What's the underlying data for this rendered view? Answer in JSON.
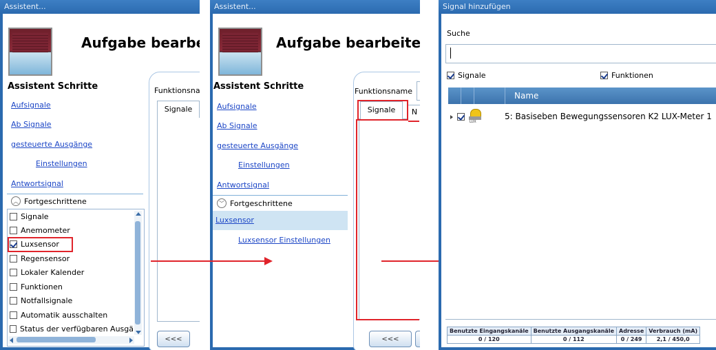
{
  "panel1": {
    "title": "Assistent...",
    "task_title": "Aufgabe bearbe",
    "steps_title": "Assistent Schritte",
    "links": [
      "Aufsignale",
      "Ab Signale",
      "gesteuerte Ausgänge",
      "Einstellungen",
      "Antwortsignal"
    ],
    "advanced_label": "Fortgeschrittene",
    "list": [
      {
        "label": "Signale",
        "checked": false
      },
      {
        "label": "Anemometer",
        "checked": false
      },
      {
        "label": "Luxsensor",
        "checked": true
      },
      {
        "label": "Regensensor",
        "checked": false
      },
      {
        "label": "Lokaler Kalender",
        "checked": false
      },
      {
        "label": "Funktionen",
        "checked": false
      },
      {
        "label": "Notfallsignale",
        "checked": false
      },
      {
        "label": "Automatik ausschalten",
        "checked": false
      },
      {
        "label": "Status der verfügbaren Ausgä",
        "checked": false
      }
    ],
    "function_name_label": "Funktionsna",
    "tab_label": "Signale",
    "back_button": "<<<"
  },
  "panel2": {
    "title": "Assistent...",
    "task_title": "Aufgabe bearbeite",
    "steps_title": "Assistent Schritte",
    "links": [
      "Aufsignale",
      "Ab Signale",
      "gesteuerte Ausgänge",
      "Einstellungen",
      "Antwortsignal"
    ],
    "advanced_label": "Fortgeschrittene",
    "selected_link": "Luxsensor",
    "sub_link": "Luxsensor Einstellungen",
    "function_name_label": "Funktionsname",
    "tab_label": "Signale",
    "tab2_label": "N",
    "back_button": "<<<"
  },
  "panel3": {
    "title": "Signal hinzufügen",
    "search_label": "Suche",
    "search_value": "",
    "filter_signals": "Signale",
    "filter_functions": "Funktionen",
    "column_name": "Name",
    "row_text": "5: Basiseben Bewegungssensoren K2 LUX-Meter 1",
    "lux_badge": "LUX",
    "status_headers": [
      "Benutzte Eingangskanäle",
      "Benutzte Ausgangskanäle",
      "Adresse",
      "Verbrauch (mA)"
    ],
    "status_values": [
      "0 / 120",
      "0 / 112",
      "0 / 249",
      "2,1 / 450,0"
    ]
  },
  "colors": {
    "accent": "#2b6aaf",
    "highlight": "#e0232a",
    "link": "#1c46c6"
  }
}
